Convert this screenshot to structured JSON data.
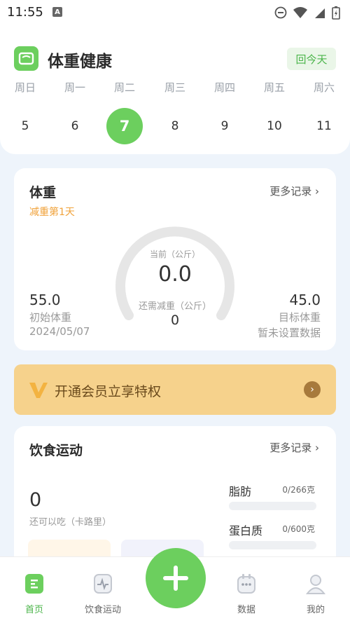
{
  "status": {
    "time": "11:55",
    "app_badge": "A"
  },
  "header": {
    "title": "体重健康",
    "today_button": "回今天",
    "weekdays": [
      "周日",
      "周一",
      "周二",
      "周三",
      "周四",
      "周五",
      "周六"
    ],
    "dates": [
      "5",
      "6",
      "7",
      "8",
      "9",
      "10",
      "11"
    ],
    "selected_index": 2
  },
  "weight_card": {
    "title": "体重",
    "subtitle": "减重第1天",
    "more": "更多记录",
    "current_label": "当前（公斤）",
    "current_value": "0.0",
    "remain_label": "还需减重（公斤）",
    "remain_value": "0",
    "initial": {
      "value": "55.0",
      "label": "初始体重",
      "date": "2024/05/07"
    },
    "target": {
      "value": "45.0",
      "label": "目标体重",
      "note": "暂未设置数据"
    }
  },
  "vip": {
    "text": "开通会员立享特权"
  },
  "diet_card": {
    "title": "饮食运动",
    "more": "更多记录",
    "calories_value": "0",
    "calories_label": "还可以吃（卡路里）",
    "nutrients": [
      {
        "name": "脂肪",
        "amount": "0/266克"
      },
      {
        "name": "蛋白质",
        "amount": "0/600克"
      }
    ]
  },
  "tabbar": {
    "tabs": [
      {
        "label": "首页",
        "icon": "home-doc-icon",
        "active": true
      },
      {
        "label": "饮食运动",
        "icon": "activity-pulse-icon",
        "active": false
      },
      {
        "label": "数据",
        "icon": "calendar-data-icon",
        "active": false
      },
      {
        "label": "我的",
        "icon": "profile-user-icon",
        "active": false
      }
    ],
    "fab": "+"
  },
  "colors": {
    "accent_green": "#6ccf5e",
    "orange_text": "#f0a23a",
    "vip_gold": "#f6d28c",
    "background": "#eef4fb"
  }
}
